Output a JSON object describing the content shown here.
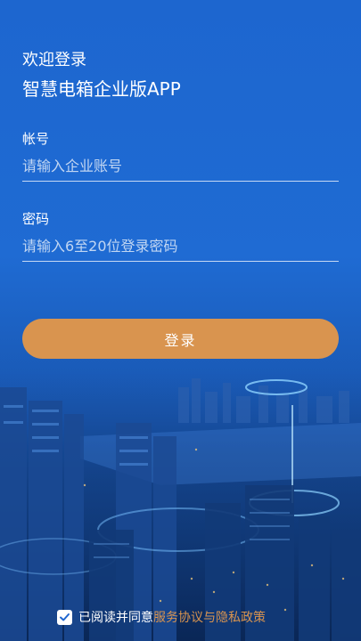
{
  "header": {
    "welcome": "欢迎登录",
    "app_title": "智慧电箱企业版APP"
  },
  "form": {
    "account_label": "帐号",
    "account_placeholder": "请输入企业账号",
    "password_label": "密码",
    "password_placeholder": "请输入6至20位登录密码",
    "login_label": "登录"
  },
  "agreement": {
    "checked": true,
    "prefix": "已阅读并同意",
    "link": "服务协议与隐私政策"
  },
  "colors": {
    "background": "#1f66cf",
    "accent": "#d9944f"
  }
}
